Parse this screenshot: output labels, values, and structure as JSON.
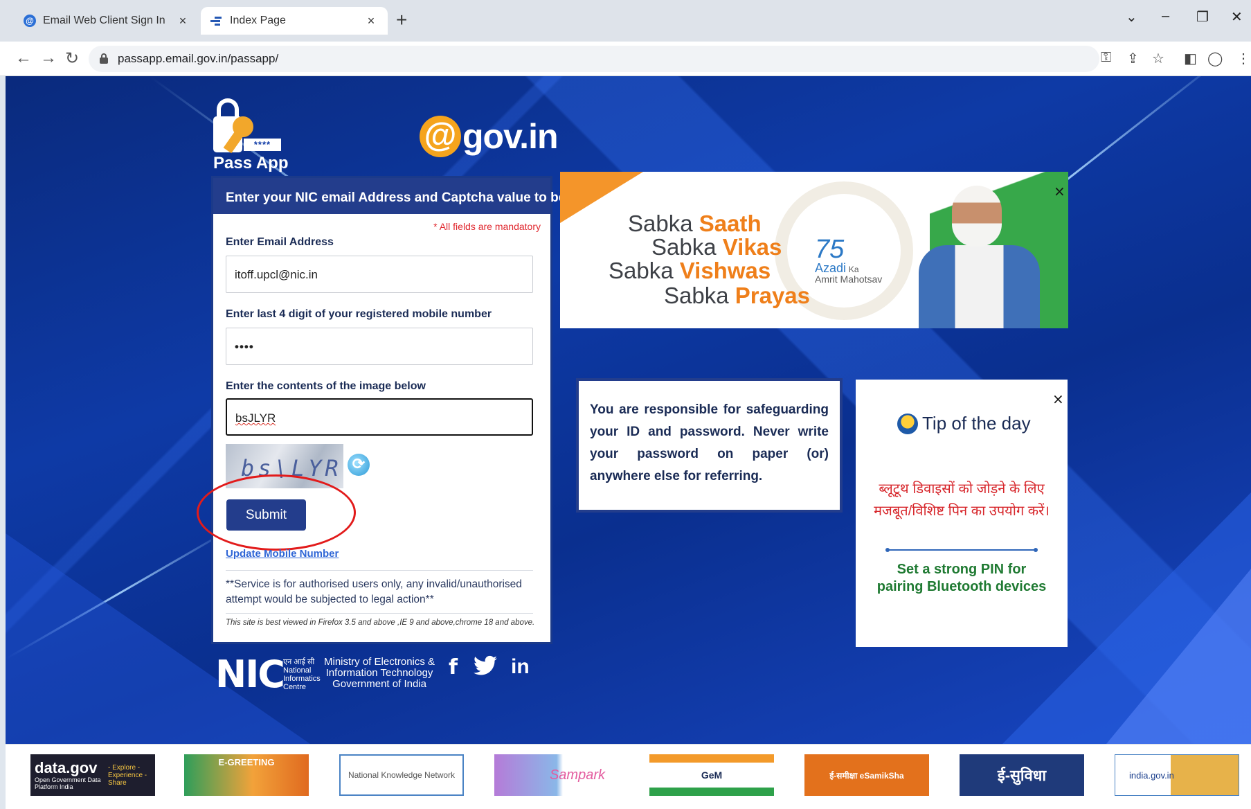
{
  "browser": {
    "tabs": [
      {
        "title": "Email Web Client Sign In",
        "active": false
      },
      {
        "title": "Index Page",
        "active": true
      }
    ],
    "url": "passapp.email.gov.in/passapp/"
  },
  "logos": {
    "passapp_stars": "****",
    "passapp_text": "Pass App",
    "gov_at": "@",
    "gov_text": "gov.in"
  },
  "form": {
    "header": "Enter your NIC email Address and Captcha value to begin",
    "mandatory_note": "* All fields are mandatory",
    "email_label": "Enter Email Address",
    "email_value": "itoff.upcl@nic.in",
    "mobile_label": "Enter last 4 digit of your registered mobile number",
    "mobile_value": "••••",
    "captcha_label": "Enter the contents of the image below",
    "captcha_value": "bsJLYR",
    "captcha_image_text": "bs\\LYR",
    "submit_label": "Submit",
    "update_link": "Update Mobile Number",
    "notice": "**Service is for authorised users only, any invalid/unauthorised attempt would be subjected to legal action**",
    "best_viewed": "This site is best viewed in Firefox 3.5 and above ,IE 9 and above,chrome 18 and above."
  },
  "footer_org": {
    "nic_logo_text": "NIC",
    "nic_hindi": "एन आई सी",
    "nic_line1": "National",
    "nic_line2": "Informatics",
    "nic_line3": "Centre",
    "meity_line1": "Ministry of Electronics &",
    "meity_line2": "Information Technology",
    "meity_line3": "Government of India",
    "social": [
      "f",
      "🐦",
      "in"
    ]
  },
  "banner": {
    "lines": [
      {
        "prefix": "Sabka ",
        "highlight": "Saath"
      },
      {
        "prefix": "Sabka ",
        "highlight": "Vikas"
      },
      {
        "prefix": "Sabka ",
        "highlight": "Vishwas"
      },
      {
        "prefix": "Sabka ",
        "highlight": "Prayas"
      }
    ],
    "azadi_num": "75",
    "azadi_line1": "Azadi",
    "azadi_ka": "Ka",
    "azadi_line2": "Amrit Mahotsav",
    "close": "×"
  },
  "info": {
    "text": "You are responsible for safeguarding your ID and password. Never write your password on paper (or) anywhere else for referring."
  },
  "tip": {
    "title": "Tip of the day",
    "hindi": "ब्लूटूथ डिवाइसों को जोड़ने के लिए मजबूत/विशिष्ट पिन का उपयोग करें।",
    "english": "Set a strong PIN for pairing Bluetooth devices",
    "close": "×"
  },
  "bottom_strip": [
    {
      "name": "data.gov.in",
      "text": "data.gov",
      "sub": "Open Government Data Platform India",
      "bullets": "- Explore - Experience - Share"
    },
    {
      "name": "e-greeting",
      "text": "E-GREETING"
    },
    {
      "name": "national-knowledge-network",
      "text": "National Knowledge Network"
    },
    {
      "name": "e-sampark",
      "text": "Sampark"
    },
    {
      "name": "gem",
      "text": "GeM"
    },
    {
      "name": "e-samiksha",
      "text": "ई-समीक्षा eSamikSha"
    },
    {
      "name": "e-suvidha",
      "text": "ई-सुविधा"
    },
    {
      "name": "india-gov-in",
      "text": "india.gov.in"
    }
  ],
  "colors": {
    "brand_blue": "#233d8c",
    "page_bg": "#0e3aa6",
    "saffron": "#ef7f1a",
    "green": "#37a84a",
    "alert_red": "#e0262d",
    "highlight_ring": "#e21b1b"
  }
}
